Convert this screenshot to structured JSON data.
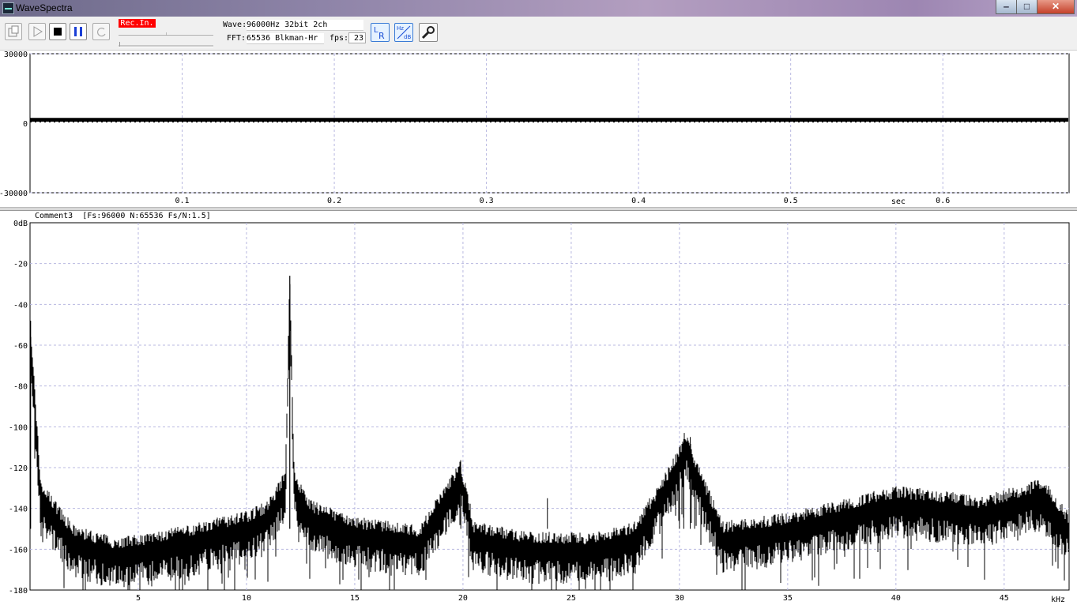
{
  "window": {
    "title": "WaveSpectra",
    "buttons": {
      "minimize": "‒",
      "maximize": "□",
      "close": "✕"
    }
  },
  "toolbar": {
    "rec_badge": "Rec.In.",
    "wave_label": "Wave:",
    "wave_value": "96000Hz 32bit 2ch",
    "fft_label": "FFT:",
    "fft_value": "65536 Blkman-Hr",
    "fps_label": "fps:",
    "fps_value": "23",
    "icons": [
      "open-icon",
      "play-icon",
      "stop-icon",
      "pause-icon",
      "loop-icon",
      "lr-channel-icon",
      "hz-db-icon",
      "wrench-settings-icon"
    ],
    "lr_button_text": "LR",
    "hzdb_top": "Hz",
    "hzdb_bottom": "dB"
  },
  "wave_view": {
    "y_ticks": [
      "30000",
      "0",
      "-30000"
    ],
    "x_ticks": [
      "0.1",
      "0.2",
      "0.3",
      "0.4",
      "0.5",
      "0.6"
    ],
    "x_unit": "sec"
  },
  "spectrum_view": {
    "header": "Comment3  [Fs:96000 N:65536 Fs/N:1.5]",
    "y_ticks": [
      "0dB",
      "-20",
      "-40",
      "-60",
      "-80",
      "-100",
      "-120",
      "-140",
      "-160",
      "-180"
    ],
    "x_ticks": [
      "5",
      "10",
      "15",
      "20",
      "25",
      "30",
      "35",
      "40",
      "45"
    ],
    "x_unit": "kHz"
  },
  "chart_data": [
    {
      "type": "line",
      "series": [
        {
          "values_approx": "steady band around +1500 with amplitude of about ±800 across the full window"
        }
      ],
      "x_range": [
        0,
        0.683
      ],
      "ylim": [
        -30000,
        30000
      ],
      "xlabel": "sec",
      "grid": true
    },
    {
      "type": "line",
      "x": [
        0,
        0.5,
        2,
        4,
        6,
        8,
        10,
        11,
        11.8,
        12.0,
        12.2,
        13,
        15,
        18,
        19.9,
        20.5,
        23,
        26,
        28,
        29.8,
        30.3,
        30.7,
        32,
        35,
        38,
        40,
        42,
        44,
        46.5,
        47,
        48
      ],
      "y": [
        -48,
        -130,
        -152,
        -158,
        -155,
        -150,
        -145,
        -140,
        -125,
        -26,
        -125,
        -140,
        -148,
        -152,
        -120,
        -150,
        -155,
        -156,
        -150,
        -118,
        -105,
        -118,
        -150,
        -146,
        -138,
        -133,
        -135,
        -138,
        -130,
        -132,
        -146
      ],
      "xlim": [
        0,
        48
      ],
      "ylim": [
        -180,
        0
      ],
      "xlabel": "kHz",
      "ylabel": "dB",
      "grid": true
    }
  ]
}
